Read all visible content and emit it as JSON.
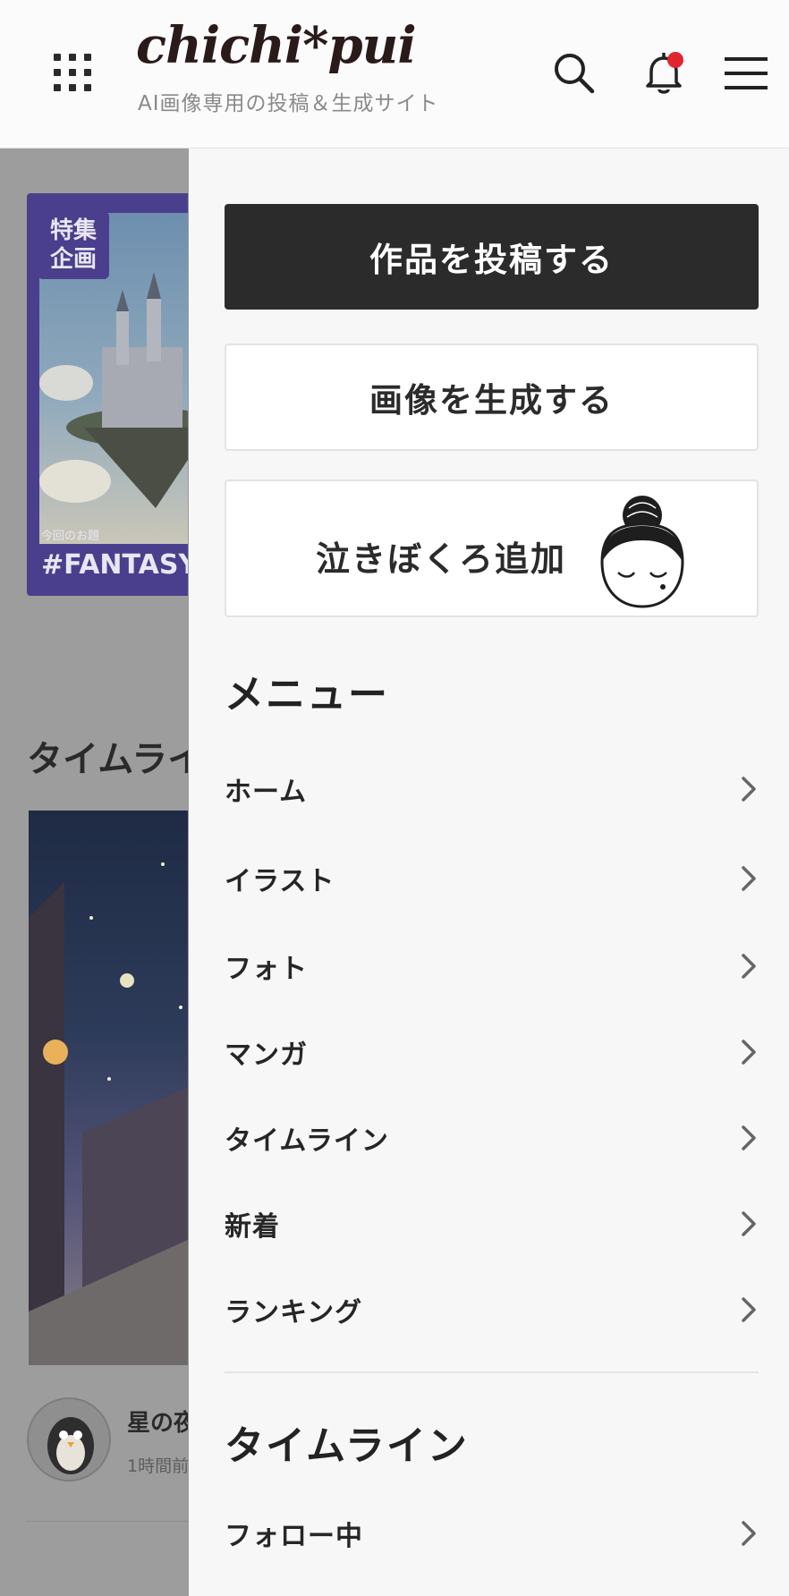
{
  "header": {
    "logo": "chichi*pui",
    "tagline": "AI画像専用の投稿＆生成サイト",
    "icons": [
      "grid-icon",
      "search-icon",
      "bell-icon",
      "hamburger-menu-icon"
    ],
    "notification_dot_color": "#e0252e"
  },
  "background": {
    "banner_badge_line1": "特集",
    "banner_badge_line2": "企画",
    "banner_sub": "今回のお題",
    "banner_tag": "#FANTASY",
    "heading": "タイムライ",
    "post_title": "星の夜",
    "post_time": "1時間前"
  },
  "drawer": {
    "post_button": "作品を投稿する",
    "generate_button": "画像を生成する",
    "feature_button": "泣きぼくろ追加",
    "menu_title": "メニュー",
    "menu_items": [
      {
        "label": "ホーム"
      },
      {
        "label": "イラスト"
      },
      {
        "label": "フォト"
      },
      {
        "label": "マンガ"
      },
      {
        "label": "タイムライン"
      },
      {
        "label": "新着"
      },
      {
        "label": "ランキング"
      }
    ],
    "timeline_title": "タイムライン",
    "timeline_items": [
      {
        "label": "フォロー中"
      }
    ]
  }
}
